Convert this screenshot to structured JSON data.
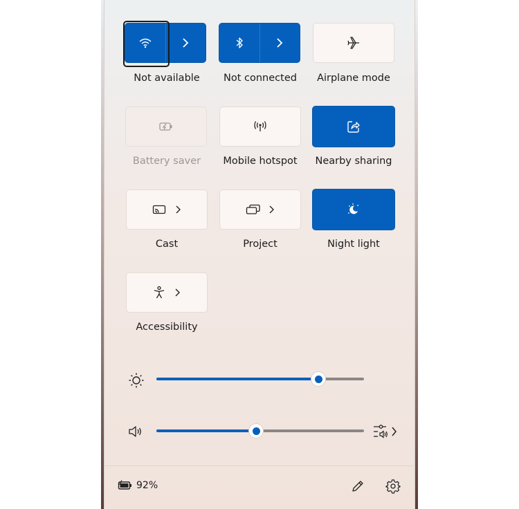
{
  "tiles": {
    "wifi": {
      "label": "Not available",
      "icon": "wifi-icon",
      "state": "on"
    },
    "bluetooth": {
      "label": "Not connected",
      "icon": "bluetooth-icon",
      "state": "on"
    },
    "airplane": {
      "label": "Airplane mode",
      "icon": "airplane-icon",
      "state": "off"
    },
    "battery_saver": {
      "label": "Battery saver",
      "icon": "battery-saver-icon",
      "state": "disabled"
    },
    "hotspot": {
      "label": "Mobile hotspot",
      "icon": "hotspot-icon",
      "state": "off"
    },
    "nearby": {
      "label": "Nearby sharing",
      "icon": "share-icon",
      "state": "on"
    },
    "cast": {
      "label": "Cast",
      "icon": "cast-icon",
      "state": "off"
    },
    "project": {
      "label": "Project",
      "icon": "project-icon",
      "state": "off"
    },
    "night_light": {
      "label": "Night light",
      "icon": "night-light-icon",
      "state": "on"
    },
    "accessibility": {
      "label": "Accessibility",
      "icon": "accessibility-icon",
      "state": "off"
    }
  },
  "sliders": {
    "brightness": {
      "icon": "brightness-icon",
      "value_fraction": 0.78
    },
    "volume": {
      "icon": "speaker-icon",
      "value_fraction": 0.48
    }
  },
  "footer": {
    "battery_percent": "92%",
    "battery_icon": "battery-charging-icon",
    "edit_icon": "pencil-icon",
    "settings_icon": "gear-icon"
  },
  "colors": {
    "accent": "#0560bd",
    "tile_off": "#fbf6f3",
    "text": "#1b1b1b"
  }
}
